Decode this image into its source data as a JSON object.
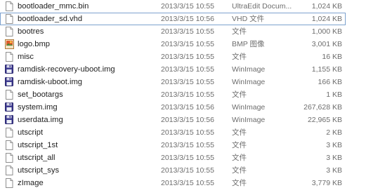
{
  "files": [
    {
      "name": "bootloader_mmc.bin",
      "date": "2013/3/15 10:55",
      "type": "UltraEdit Docum...",
      "size": "1,024 KB",
      "icon": "file-icon"
    },
    {
      "name": "bootloader_sd.vhd",
      "date": "2013/3/15 10:56",
      "type": "VHD 文件",
      "size": "1,024 KB",
      "icon": "file-icon",
      "selected": true
    },
    {
      "name": "bootres",
      "date": "2013/3/15 10:55",
      "type": "文件",
      "size": "1,000 KB",
      "icon": "file-icon"
    },
    {
      "name": "logo.bmp",
      "date": "2013/3/15 10:55",
      "type": "BMP 图像",
      "size": "3,001 KB",
      "icon": "bmp-image-icon"
    },
    {
      "name": "misc",
      "date": "2013/3/15 10:55",
      "type": "文件",
      "size": "16 KB",
      "icon": "file-icon"
    },
    {
      "name": "ramdisk-recovery-uboot.img",
      "date": "2013/3/15 10:55",
      "type": "WinImage",
      "size": "1,155 KB",
      "icon": "disk-image-icon"
    },
    {
      "name": "ramdisk-uboot.img",
      "date": "2013/3/15 10:55",
      "type": "WinImage",
      "size": "166 KB",
      "icon": "disk-image-icon"
    },
    {
      "name": "set_bootargs",
      "date": "2013/3/15 10:55",
      "type": "文件",
      "size": "1 KB",
      "icon": "file-icon"
    },
    {
      "name": "system.img",
      "date": "2013/3/15 10:56",
      "type": "WinImage",
      "size": "267,628 KB",
      "icon": "disk-image-icon"
    },
    {
      "name": "userdata.img",
      "date": "2013/3/15 10:56",
      "type": "WinImage",
      "size": "22,965 KB",
      "icon": "disk-image-icon"
    },
    {
      "name": "utscript",
      "date": "2013/3/15 10:55",
      "type": "文件",
      "size": "2 KB",
      "icon": "file-icon"
    },
    {
      "name": "utscript_1st",
      "date": "2013/3/15 10:55",
      "type": "文件",
      "size": "3 KB",
      "icon": "file-icon"
    },
    {
      "name": "utscript_all",
      "date": "2013/3/15 10:55",
      "type": "文件",
      "size": "3 KB",
      "icon": "file-icon"
    },
    {
      "name": "utscript_sys",
      "date": "2013/3/15 10:55",
      "type": "文件",
      "size": "3 KB",
      "icon": "file-icon"
    },
    {
      "name": "zImage",
      "date": "2013/3/15 10:55",
      "type": "文件",
      "size": "3,779 KB",
      "icon": "file-icon"
    }
  ],
  "colors": {
    "selection_border": "#7da2ce",
    "disk_icon": "#3d3a8f",
    "secondary_text": "#6d6d6d"
  }
}
